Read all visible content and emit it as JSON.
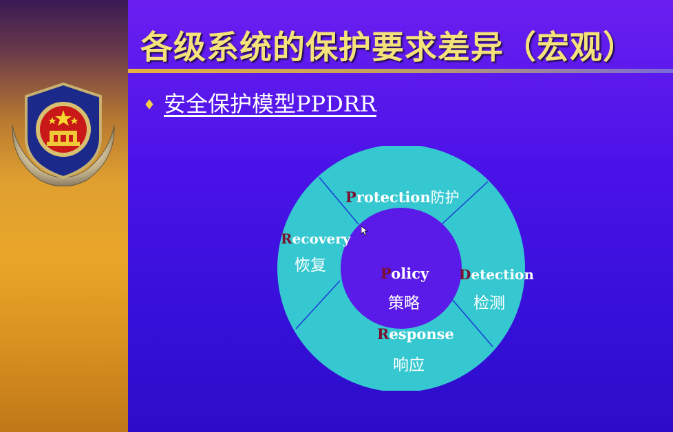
{
  "slide": {
    "title": "各级系统的保护要求差异（宏观）",
    "bullet": "安全保护模型PPDRR"
  },
  "diagram": {
    "center": {
      "cap": "P",
      "rest": "olicy",
      "zh": "策略"
    },
    "protection": {
      "cap": "P",
      "rest": "rotection",
      "zh": "防护"
    },
    "detection": {
      "cap": "D",
      "rest": "etection",
      "zh": "检测"
    },
    "response": {
      "cap": "R",
      "rest": "esponse",
      "zh": "响应"
    },
    "recovery": {
      "cap": "R",
      "rest": "ecovery",
      "zh": "恢复"
    }
  },
  "colors": {
    "ring": "#36c8d0",
    "inner": "#5a1ae8",
    "divider": "#1a3ad8",
    "title": "#f5e27a",
    "capital": "#7a1030"
  },
  "icons": {
    "emblem": "police-emblem-icon",
    "bullet": "diamond-bullet-icon",
    "cursor": "mouse-pointer-icon"
  }
}
